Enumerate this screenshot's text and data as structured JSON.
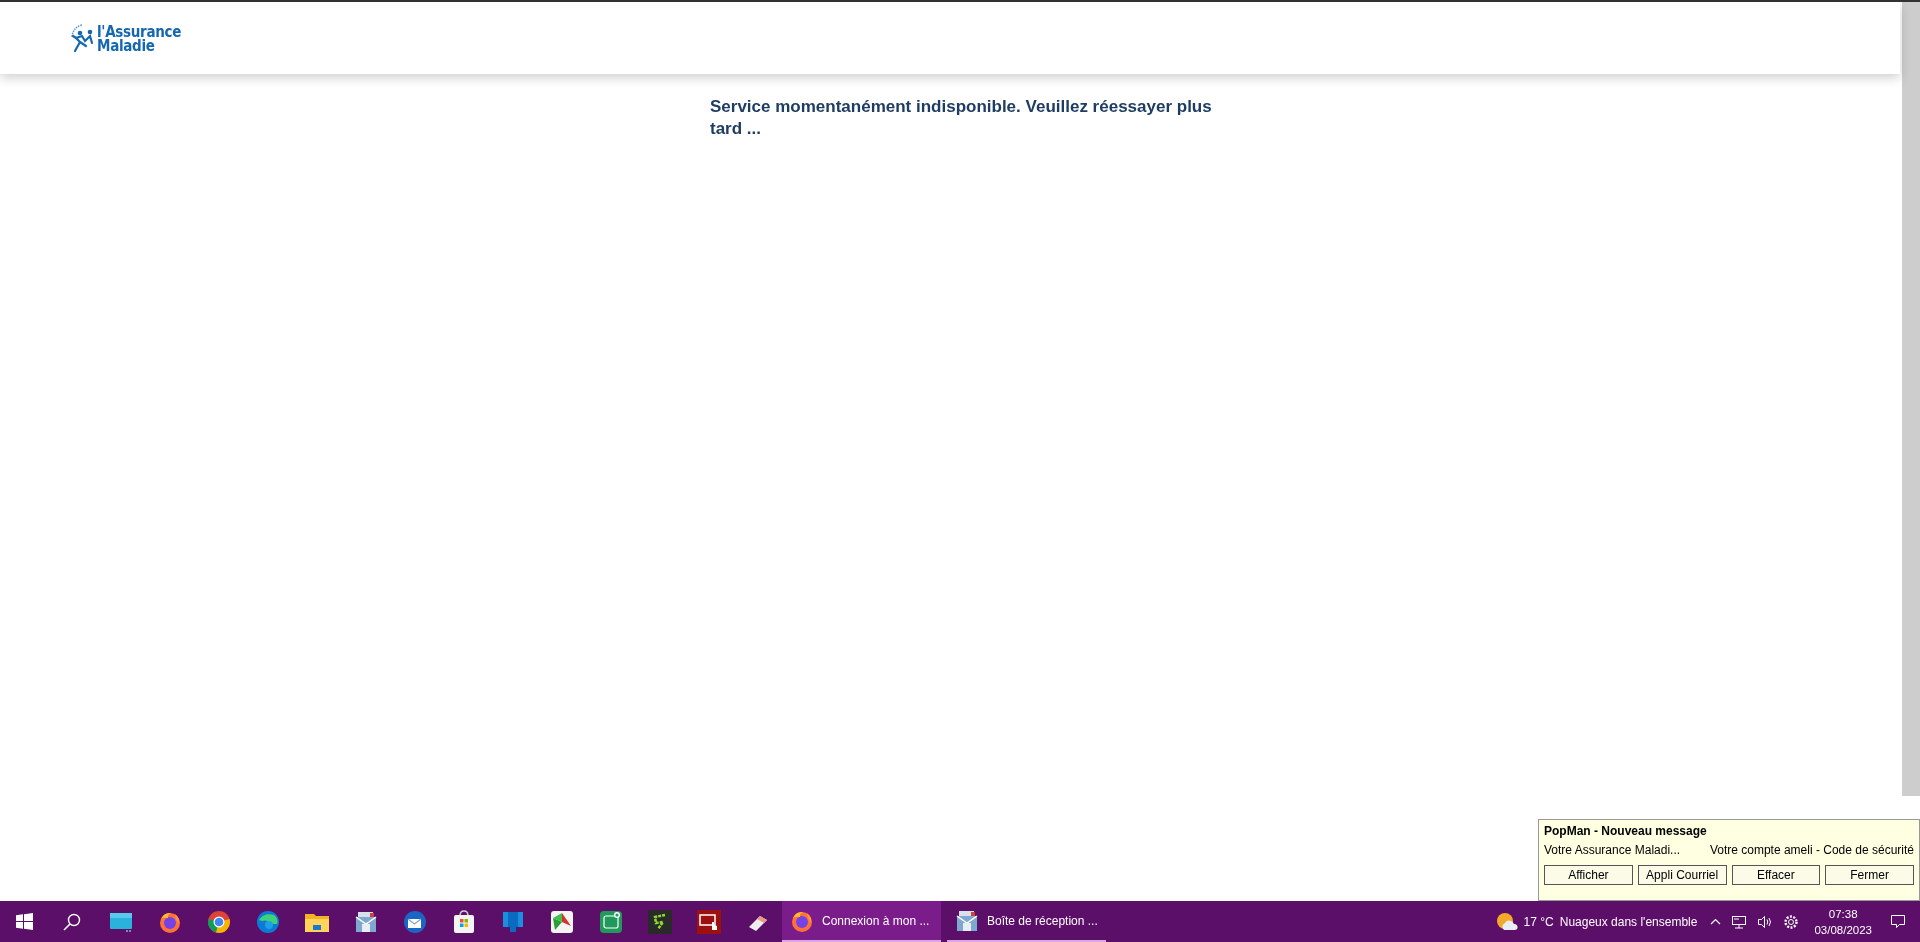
{
  "header": {
    "logo": {
      "line_1": "l'Assurance",
      "line_2": "Maladie"
    }
  },
  "message": "Service momentanément indisponible. Veuillez réessayer plus tard ...",
  "notification": {
    "title": "PopMan - Nouveau message",
    "sender": "Votre Assurance Maladi...",
    "subject": "Votre compte ameli - Code de sécurité",
    "buttons": [
      "Afficher",
      "Appli Courriel",
      "Effacer",
      "Fermer"
    ]
  },
  "taskbar": {
    "tasks": [
      {
        "kind": "browser",
        "label": "Connexion à mon ...",
        "selected": true
      },
      {
        "kind": "mail",
        "label": "Boîte de réception ...",
        "selected": false
      }
    ],
    "weather": {
      "temperature": "17 °C",
      "condition": "Nuageux dans l'ensemble"
    },
    "clock": {
      "time": "07:38",
      "date": "03/08/2023"
    }
  }
}
